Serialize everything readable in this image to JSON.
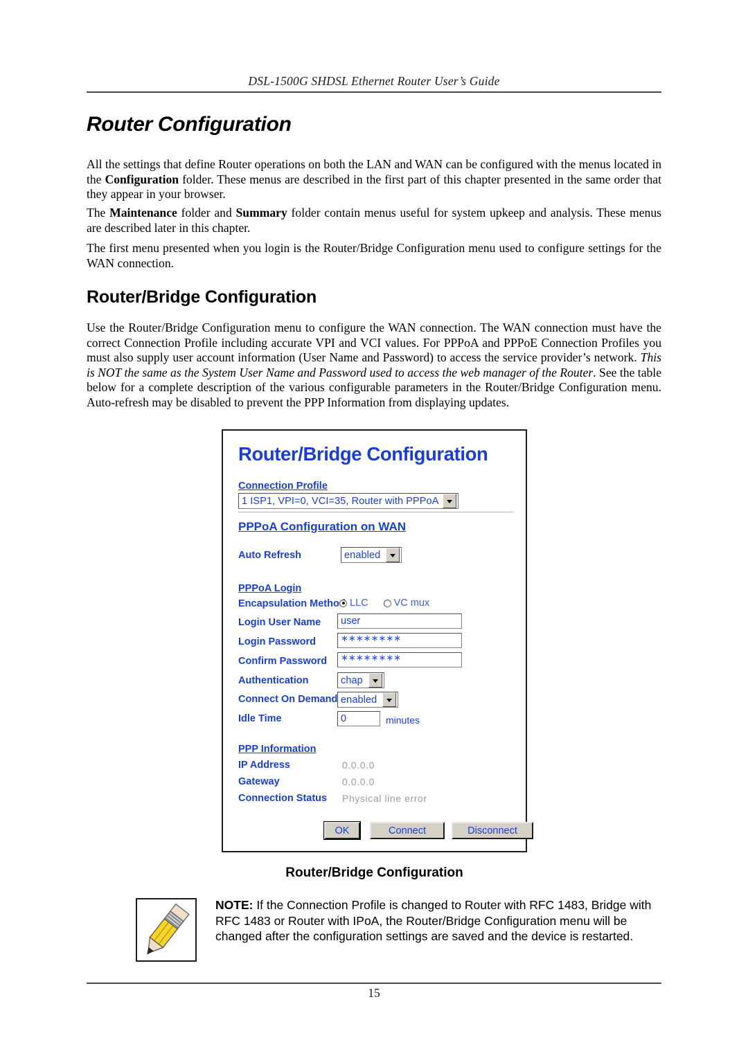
{
  "document": {
    "running_head": "DSL-1500G SHDSL Ethernet Router User’s Guide",
    "page_number": "15",
    "heading_1": "Router Configuration",
    "heading_2": "Router/Bridge Configuration",
    "paragraph_1_html": "All the settings that define Router operations on both the LAN and WAN can be configured with the menus located in the <b>Configuration</b> folder. These menus are described in the first part of this chapter presented in the same order that they appear in your browser.",
    "paragraph_2_html": "The <b>Maintenance</b> folder and <b>Summary</b> folder contain menus useful for system upkeep and analysis. These menus are described later in this chapter.",
    "paragraph_3_html": "The first menu presented when you login is the Router/Bridge Configuration menu used to configure settings for the WAN connection.",
    "paragraph_4_html": "Use the Router/Bridge Configuration menu to configure the WAN connection. The WAN connection must have the correct Connection Profile including accurate VPI and VCI values. For PPPoA and PPPoE Connection Profiles you must also supply user account information (User Name and Password) to access the service provider’s network. <i>This is NOT the same as the System User Name and Password used to access the web manager of the Router</i>. See the table below for a complete description of the various configurable parameters in the Router/Bridge Configuration menu. Auto-refresh may be disabled to prevent the PPP Information from displaying updates."
  },
  "figure": {
    "caption": "Router/Bridge Configuration",
    "screenshot": {
      "title": "Router/Bridge Configuration",
      "connection_profile": {
        "link_label": "Connection Profile",
        "selected": "1 ISP1,  VPI=0,  VCI=35,  Router with PPPoA"
      },
      "section_wan": {
        "link_label": "PPPoA Configuration on WAN",
        "auto_refresh_label": "Auto Refresh",
        "auto_refresh_value": "enabled"
      },
      "section_login": {
        "link_label": "PPPoA Login",
        "encapsulation_label": "Encapsulation Method",
        "encapsulation_options": [
          "LLC",
          "VC mux"
        ],
        "encapsulation_selected": "LLC",
        "login_user_name_label": "Login User Name",
        "login_user_name_value": "user",
        "login_password_label": "Login Password",
        "login_password_value": "∗∗∗∗∗∗∗∗",
        "confirm_password_label": "Confirm Password",
        "confirm_password_value": "∗∗∗∗∗∗∗∗",
        "authentication_label": "Authentication",
        "authentication_value": "chap",
        "connect_on_demand_label": "Connect On Demand",
        "connect_on_demand_value": "enabled",
        "idle_time_label": "Idle Time",
        "idle_time_value": "0",
        "idle_time_unit": "minutes"
      },
      "section_ppp_info": {
        "link_label": "PPP Information",
        "ip_address_label": "IP Address",
        "ip_address_value": "0.0.0.0",
        "gateway_label": "Gateway",
        "gateway_value": "0.0.0.0",
        "connection_status_label": "Connection Status",
        "connection_status_value": "Physical line error"
      },
      "buttons": {
        "ok": "OK",
        "connect": "Connect",
        "disconnect": "Disconnect"
      },
      "colors": {
        "link_blue": "#1a3fd0",
        "button_face": "#d4d0c8",
        "readonly_gray": "#9b9b9b"
      }
    }
  },
  "note": {
    "icon_name": "pencil-icon",
    "prefix": "NOTE:",
    "body": " If the Connection Profile is changed to Router with RFC 1483, Bridge with RFC 1483 or Router with IPoA, the Router/Bridge Configuration menu will be changed after the configuration settings are saved and the device is restarted."
  }
}
